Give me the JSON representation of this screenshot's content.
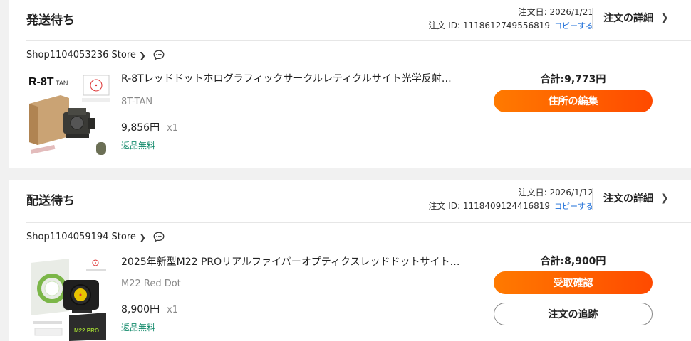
{
  "orders": [
    {
      "status": "発送待ち",
      "order_date": "注文日: 2026/1/21",
      "order_id": "注文 ID: 1118612749556819",
      "copy_label": "コピーする",
      "detail_label": "注文の詳細",
      "shop_name": "Shop1104053236 Store",
      "product_title": "R-8Tレッドドットホログラフィックサークルレティクルサイト光学反射…",
      "variant": "8T-TAN",
      "price": "9,856円",
      "quantity": "x1",
      "free_return": "返品無料",
      "total": "合計:9,773円",
      "primary_button": "住所の編集",
      "thumb_label": "R-8T",
      "thumb_sub": "TAN"
    },
    {
      "status": "配送待ち",
      "order_date": "注文日: 2026/1/12",
      "order_id": "注文 ID: 1118409124416819",
      "copy_label": "コピーする",
      "detail_label": "注文の詳細",
      "shop_name": "Shop1104059194 Store",
      "product_title": "2025年新型M22 PROリアルファイバーオプティクスレッドドットサイト…",
      "variant": "M22 Red Dot",
      "price": "8,900円",
      "quantity": "x1",
      "free_return": "返品無料",
      "total": "合計:8,900円",
      "primary_button": "受取確認",
      "secondary_button": "注文の追跡",
      "thumb_label": "M22 PRO"
    }
  ],
  "colors": {
    "accent": "#ff5a00",
    "link": "#1e6fd9",
    "free": "#138a6b"
  }
}
